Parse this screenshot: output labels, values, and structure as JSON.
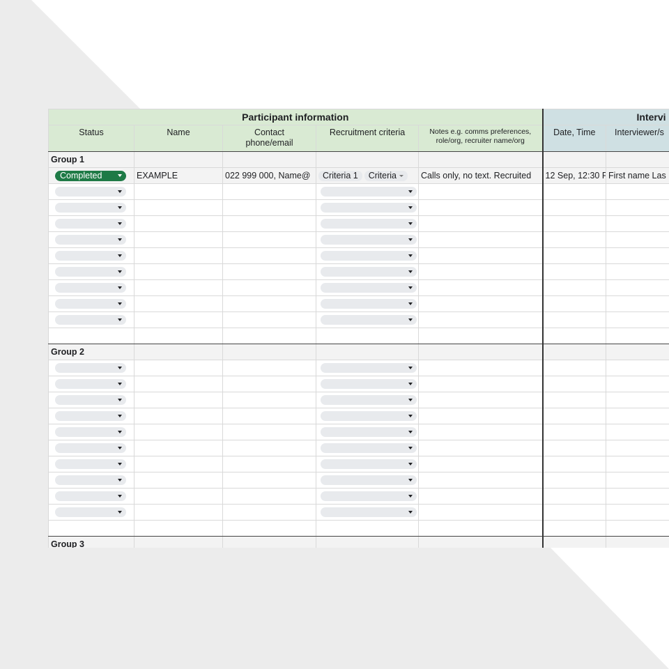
{
  "banner": {
    "participant": "Participant information",
    "interview": "Intervi"
  },
  "headers": {
    "status": "Status",
    "name": "Name",
    "contact": "Contact phone/email",
    "criteria": "Recruitment criteria",
    "notes": "Notes e.g. comms preferences, role/org, recruiter name/org",
    "date": "Date, Time",
    "interviewer": "Interviewer/s"
  },
  "groups": {
    "group1": "Group 1",
    "group2": "Group 2",
    "group3": "Group 3"
  },
  "example": {
    "status": "Completed",
    "name": "EXAMPLE",
    "contact": "022 999 000, Name@",
    "criteria1": "Criteria 1",
    "criteria2": "Criteria",
    "notes": "Calls only, no text. Recruited",
    "date": "12 Sep, 12:30 P",
    "interviewer": "First name Las"
  },
  "colors": {
    "participant_header": "#d9ead3",
    "interview_header": "#cfe0e3",
    "status_completed": "#1e7a46"
  }
}
